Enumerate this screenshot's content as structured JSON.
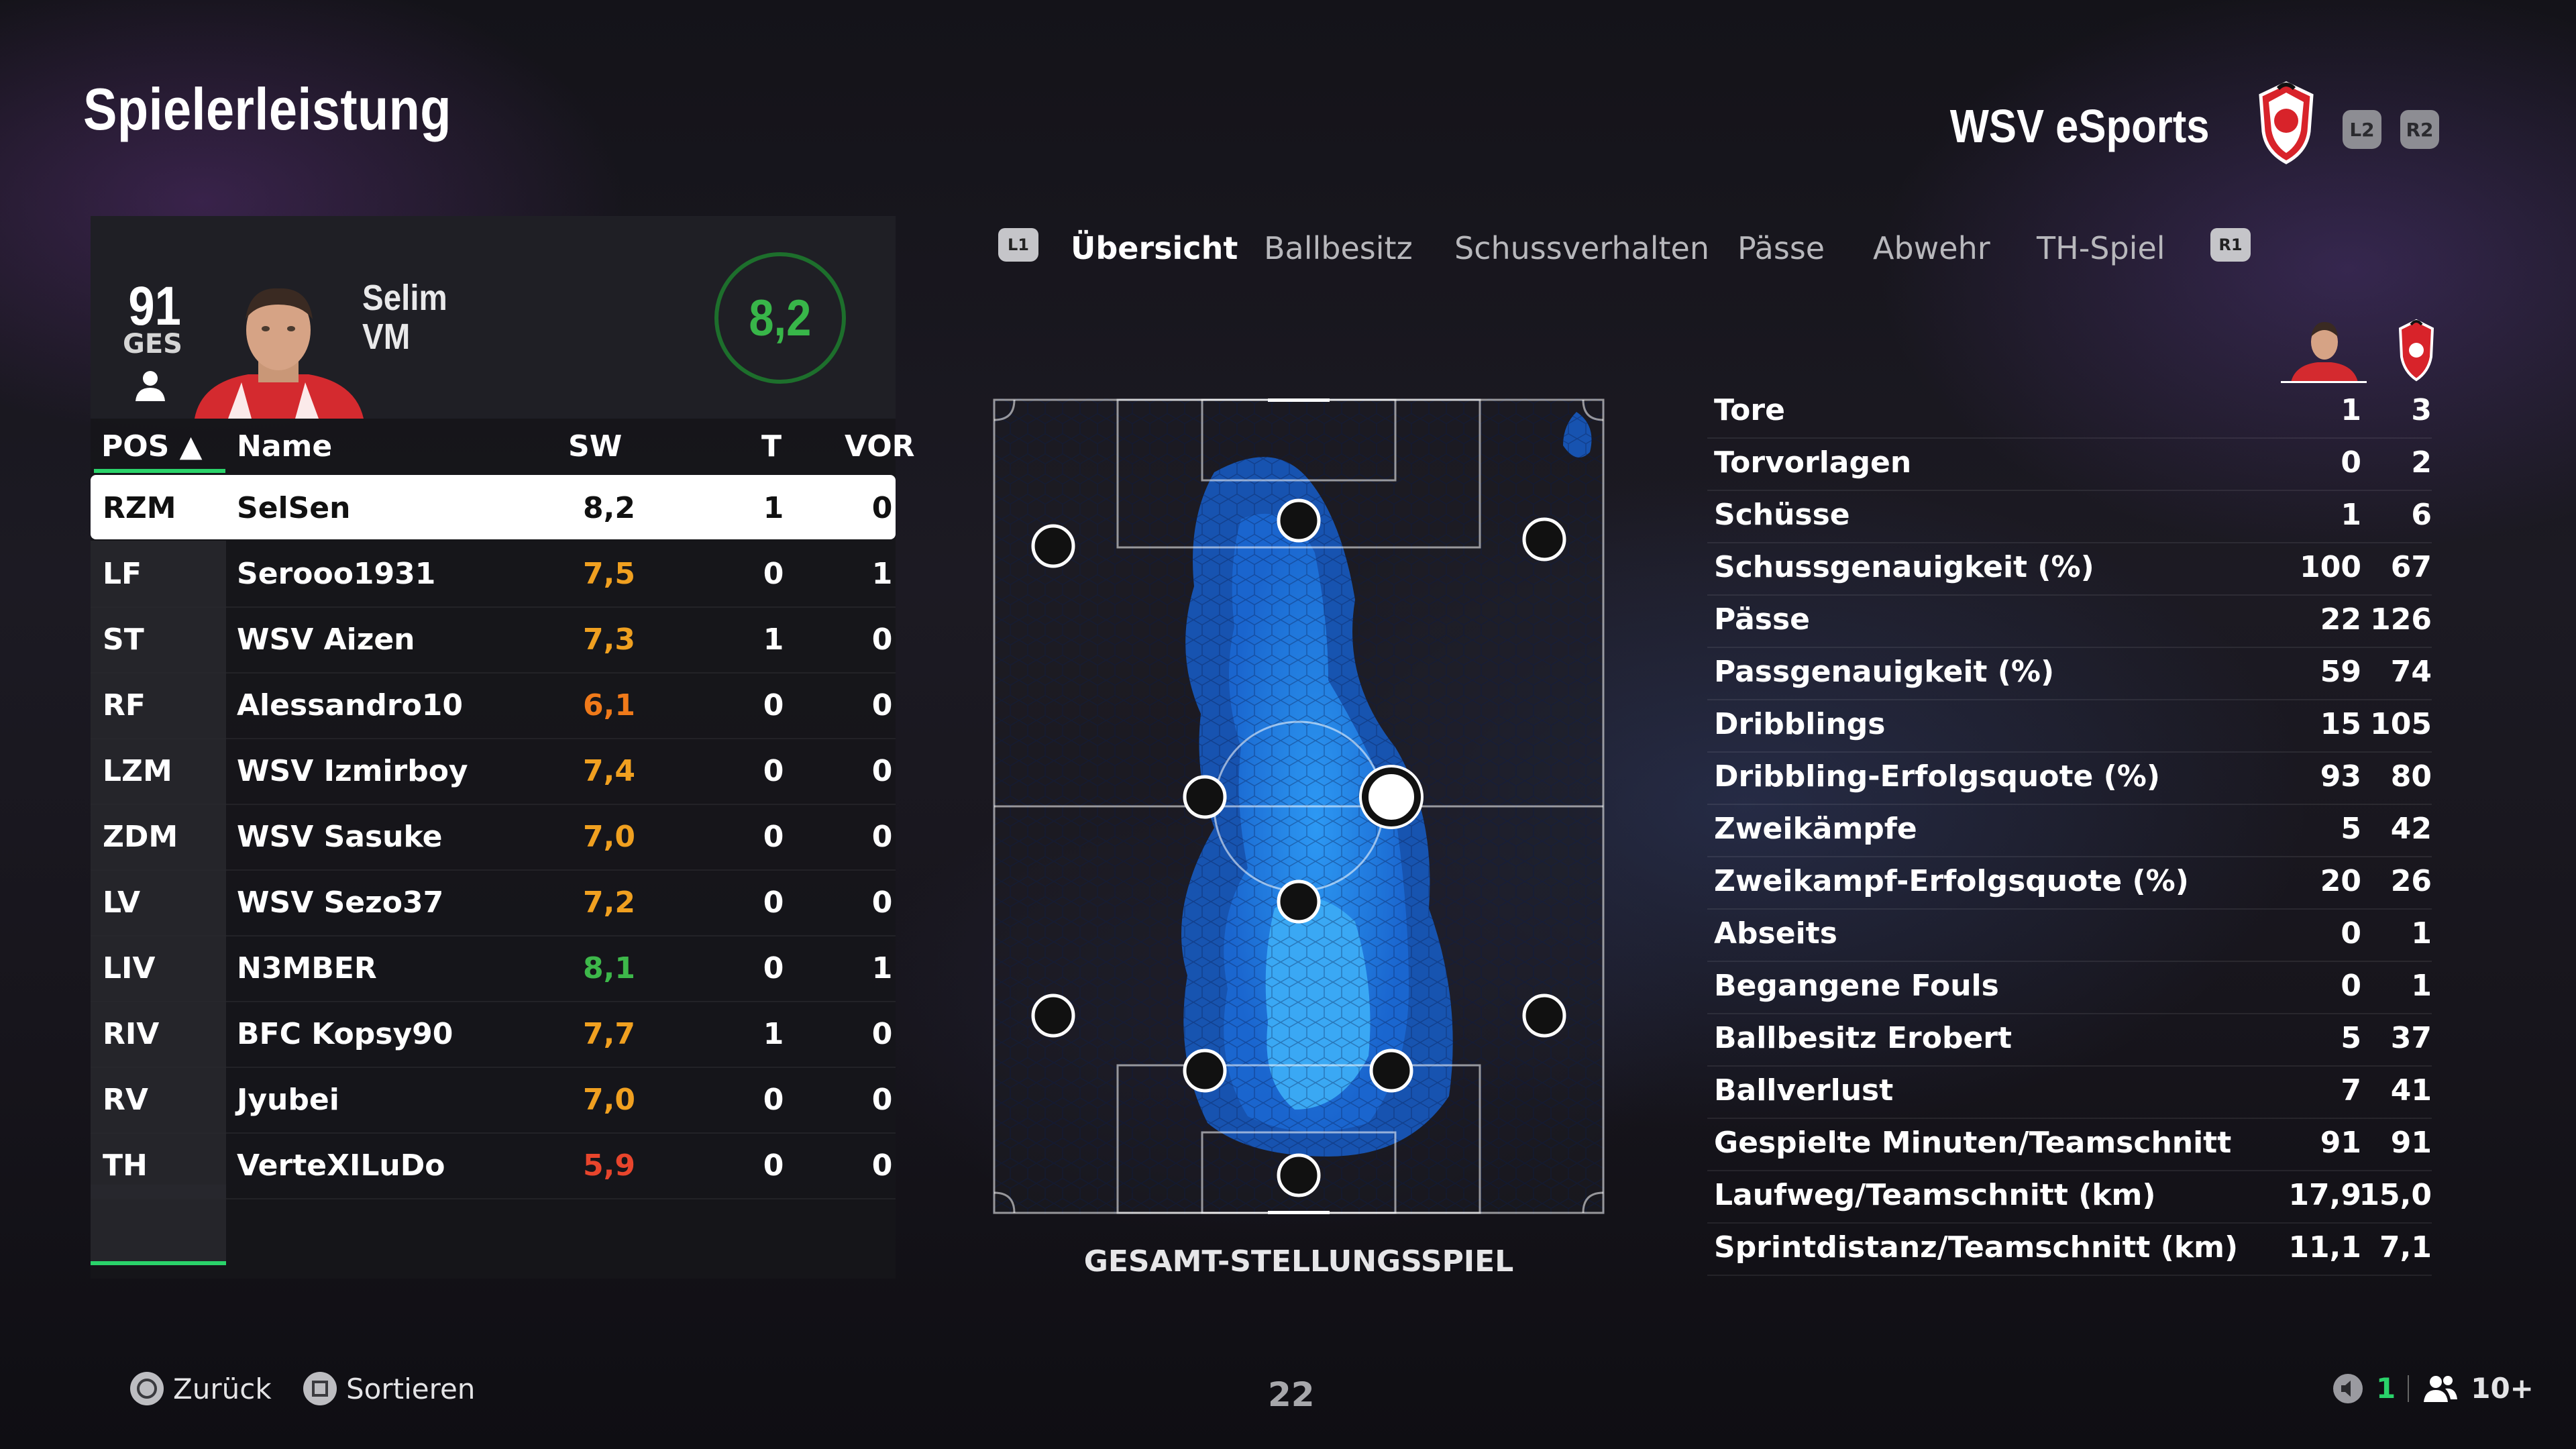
{
  "header": {
    "title": "Spielerleistung",
    "team": "WSV eSports",
    "l2": "L2",
    "r2": "R2"
  },
  "player": {
    "ovr": "91",
    "ovr_label": "GES",
    "first_name": "Selim",
    "position": "VM",
    "rating": "8,2"
  },
  "table": {
    "headers": {
      "pos": "POS ▲",
      "name": "Name",
      "sw": "SW",
      "t": "T",
      "vor": "VOR"
    },
    "rows": [
      {
        "pos": "RZM",
        "name": "SelSen",
        "sw": "8,2",
        "t": "1",
        "vor": "0",
        "color": "#111111"
      },
      {
        "pos": "LF",
        "name": "Serooo1931",
        "sw": "7,5",
        "t": "0",
        "vor": "1",
        "color": "#f0a020"
      },
      {
        "pos": "ST",
        "name": "WSV Aizen",
        "sw": "7,3",
        "t": "1",
        "vor": "0",
        "color": "#f0a020"
      },
      {
        "pos": "RF",
        "name": "Alessandro10",
        "sw": "6,1",
        "t": "0",
        "vor": "0",
        "color": "#f07a1a"
      },
      {
        "pos": "LZM",
        "name": "WSV Izmirboy",
        "sw": "7,4",
        "t": "0",
        "vor": "0",
        "color": "#f0a020"
      },
      {
        "pos": "ZDM",
        "name": "WSV Sasuke",
        "sw": "7,0",
        "t": "0",
        "vor": "0",
        "color": "#f0a020"
      },
      {
        "pos": "LV",
        "name": "WSV Sezo37",
        "sw": "7,2",
        "t": "0",
        "vor": "0",
        "color": "#f0a020"
      },
      {
        "pos": "LIV",
        "name": "N3MBER",
        "sw": "8,1",
        "t": "0",
        "vor": "1",
        "color": "#3db84a"
      },
      {
        "pos": "RIV",
        "name": "BFC Kopsy90",
        "sw": "7,7",
        "t": "1",
        "vor": "0",
        "color": "#f0a020"
      },
      {
        "pos": "RV",
        "name": "Jyubei",
        "sw": "7,0",
        "t": "0",
        "vor": "0",
        "color": "#f0a020"
      },
      {
        "pos": "TH",
        "name": "VerteXILuDo",
        "sw": "5,9",
        "t": "0",
        "vor": "0",
        "color": "#e8452c"
      }
    ]
  },
  "tabs": {
    "l1": "L1",
    "r1": "R1",
    "items": [
      "Übersicht",
      "Ballbesitz",
      "Schussverhalten",
      "Pässe",
      "Abwehr",
      "TH-Spiel"
    ]
  },
  "pitch": {
    "label": "GESAMT-STELLUNGSSPIEL"
  },
  "stats": [
    {
      "label": "Tore",
      "player": "1",
      "team": "3"
    },
    {
      "label": "Torvorlagen",
      "player": "0",
      "team": "2"
    },
    {
      "label": "Schüsse",
      "player": "1",
      "team": "6"
    },
    {
      "label": "Schussgenauigkeit (%)",
      "player": "100",
      "team": "67"
    },
    {
      "label": "Pässe",
      "player": "22",
      "team": "126"
    },
    {
      "label": "Passgenauigkeit (%)",
      "player": "59",
      "team": "74"
    },
    {
      "label": "Dribblings",
      "player": "15",
      "team": "105"
    },
    {
      "label": "Dribbling-Erfolgsquote (%)",
      "player": "93",
      "team": "80"
    },
    {
      "label": "Zweikämpfe",
      "player": "5",
      "team": "42"
    },
    {
      "label": "Zweikampf-Erfolgsquote (%)",
      "player": "20",
      "team": "26"
    },
    {
      "label": "Abseits",
      "player": "0",
      "team": "1"
    },
    {
      "label": "Begangene Fouls",
      "player": "0",
      "team": "1"
    },
    {
      "label": "Ballbesitz Erobert",
      "player": "5",
      "team": "37"
    },
    {
      "label": "Ballverlust",
      "player": "7",
      "team": "41"
    },
    {
      "label": "Gespielte Minuten/Teamschnitt",
      "player": "91",
      "team": "91"
    },
    {
      "label": "Laufweg/Teamschnitt (km)",
      "player": "17,9",
      "team": "15,0"
    },
    {
      "label": "Sprintdistanz/Teamschnitt (km)",
      "player": "11,1",
      "team": "7,1"
    }
  ],
  "footer": {
    "back": "Zurück",
    "sort": "Sortieren",
    "page": "22",
    "count": "1",
    "players": "10+"
  },
  "colors": {
    "accent_green": "#2ad36a",
    "rating_green": "#38b649",
    "heatmap_blue": "#1e8cff"
  }
}
